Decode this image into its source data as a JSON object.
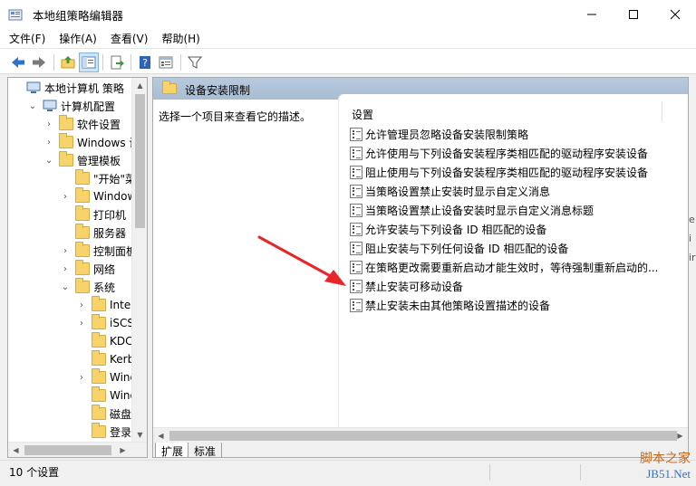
{
  "window": {
    "title": "本地组策略编辑器"
  },
  "menu": [
    "文件(F)",
    "操作(A)",
    "查看(V)",
    "帮助(H)"
  ],
  "tree": {
    "items": [
      {
        "label": "本地计算机 策略",
        "level": 0,
        "expander": "none",
        "icon": "computer-policy-icon"
      },
      {
        "label": "计算机配置",
        "level": 1,
        "expander": "expanded",
        "icon": "computer-icon"
      },
      {
        "label": "软件设置",
        "level": 2,
        "expander": "collapsed",
        "icon": "folder-icon"
      },
      {
        "label": "Windows 设置",
        "level": 2,
        "expander": "collapsed",
        "icon": "folder-icon"
      },
      {
        "label": "管理模板",
        "level": 2,
        "expander": "expanded",
        "icon": "folder-icon"
      },
      {
        "label": "\"开始\"菜单",
        "level": 3,
        "expander": "none",
        "icon": "folder-icon"
      },
      {
        "label": "Windows",
        "level": 3,
        "expander": "collapsed",
        "icon": "folder-icon"
      },
      {
        "label": "打印机",
        "level": 3,
        "expander": "none",
        "icon": "folder-icon"
      },
      {
        "label": "服务器",
        "level": 3,
        "expander": "none",
        "icon": "folder-icon"
      },
      {
        "label": "控制面板",
        "level": 3,
        "expander": "collapsed",
        "icon": "folder-icon"
      },
      {
        "label": "网络",
        "level": 3,
        "expander": "collapsed",
        "icon": "folder-icon"
      },
      {
        "label": "系统",
        "level": 3,
        "expander": "expanded",
        "icon": "folder-icon"
      },
      {
        "label": "Intern",
        "level": 4,
        "expander": "collapsed",
        "icon": "folder-icon"
      },
      {
        "label": "iSCSI",
        "level": 4,
        "expander": "collapsed",
        "icon": "folder-icon"
      },
      {
        "label": "KDC",
        "level": 4,
        "expander": "none",
        "icon": "folder-icon"
      },
      {
        "label": "Kerbe",
        "level": 4,
        "expander": "none",
        "icon": "folder-icon"
      },
      {
        "label": "Windo",
        "level": 4,
        "expander": "collapsed",
        "icon": "folder-icon"
      },
      {
        "label": "Windo",
        "level": 4,
        "expander": "none",
        "icon": "folder-icon"
      },
      {
        "label": "磁盘配",
        "level": 4,
        "expander": "none",
        "icon": "folder-icon"
      },
      {
        "label": "登录",
        "level": 4,
        "expander": "none",
        "icon": "folder-icon"
      }
    ]
  },
  "content": {
    "header_title": "设备安装限制",
    "description_prompt": "选择一个项目来查看它的描述。",
    "column_header": "设置",
    "settings": [
      "允许管理员忽略设备安装限制策略",
      "允许使用与下列设备安装程序类相匹配的驱动程序安装设备",
      "阻止使用与下列设备安装程序类相匹配的驱动程序安装设备",
      "当策略设置禁止安装时显示自定义消息",
      "当策略设置禁止设备安装时显示自定义消息标题",
      "允许安装与下列设备 ID 相匹配的设备",
      "阻止安装与下列任何设备 ID 相匹配的设备",
      "在策略更改需要重新启动才能生效时，等待强制重新启动的...",
      "禁止安装可移动设备",
      "禁止安装未由其他策略设置描述的设备"
    ],
    "tabs": [
      "扩展",
      "标准"
    ],
    "active_tab": 0
  },
  "status": {
    "text": "10 个设置"
  },
  "watermark": {
    "line1": "脚本之家",
    "line2": "JB51.Net"
  },
  "edge_fragments": [
    "e",
    "i",
    "ir"
  ],
  "colors": {
    "header_band": "#b0c3d9",
    "folder": "#f6d36b",
    "annotation_arrow": "#e8262a",
    "toolbar_blue": "#2f73c6"
  }
}
